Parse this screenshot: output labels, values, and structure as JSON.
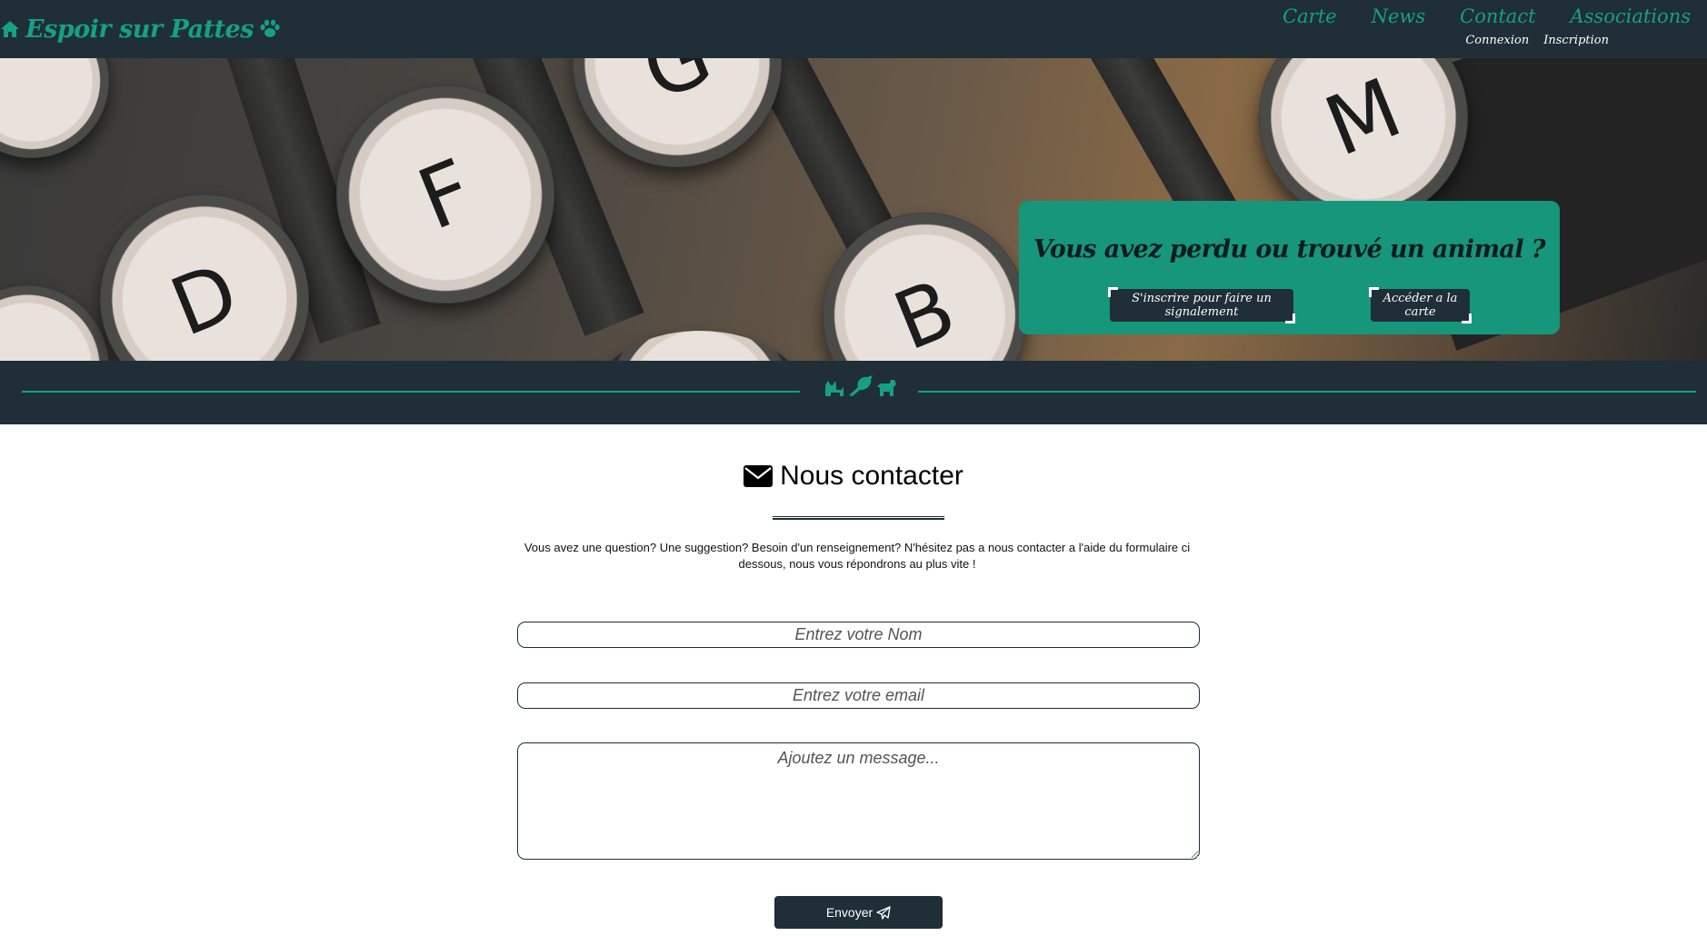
{
  "brand": {
    "name": "Espoir sur Pattes",
    "home_icon": "home-icon",
    "paw_icon": "paw-icon"
  },
  "nav": {
    "main": [
      "Carte",
      "News",
      "Contact",
      "Associations"
    ],
    "sub": [
      "Connexion",
      "Inscription"
    ]
  },
  "hero": {
    "keys": [
      "G",
      "M",
      "F",
      "D",
      "B"
    ],
    "card": {
      "title": "Vous avez perdu ou trouvé un animal ?",
      "btn_signal": "S'inscrire pour faire un signalement",
      "btn_carte": "Accéder a la carte"
    }
  },
  "divider": {
    "icons": [
      "cat-icon",
      "bird-icon",
      "dog-icon"
    ]
  },
  "contact": {
    "title": "Nous contacter",
    "title_icon": "envelope-icon",
    "intro": "Vous avez une question? Une suggestion? Besoin d'un renseignement? N'hésitez pas a nous contacter a l'aide du formulaire ci dessous, nous vous répondrons au plus vite !",
    "name_placeholder": "Entrez votre Nom",
    "email_placeholder": "Entrez votre email",
    "message_placeholder": "Ajoutez un message...",
    "send_label": "Envoyer",
    "send_icon": "paper-plane-icon"
  },
  "colors": {
    "dark": "#1f2e37",
    "accent": "#16a085",
    "card": "#16967a"
  }
}
